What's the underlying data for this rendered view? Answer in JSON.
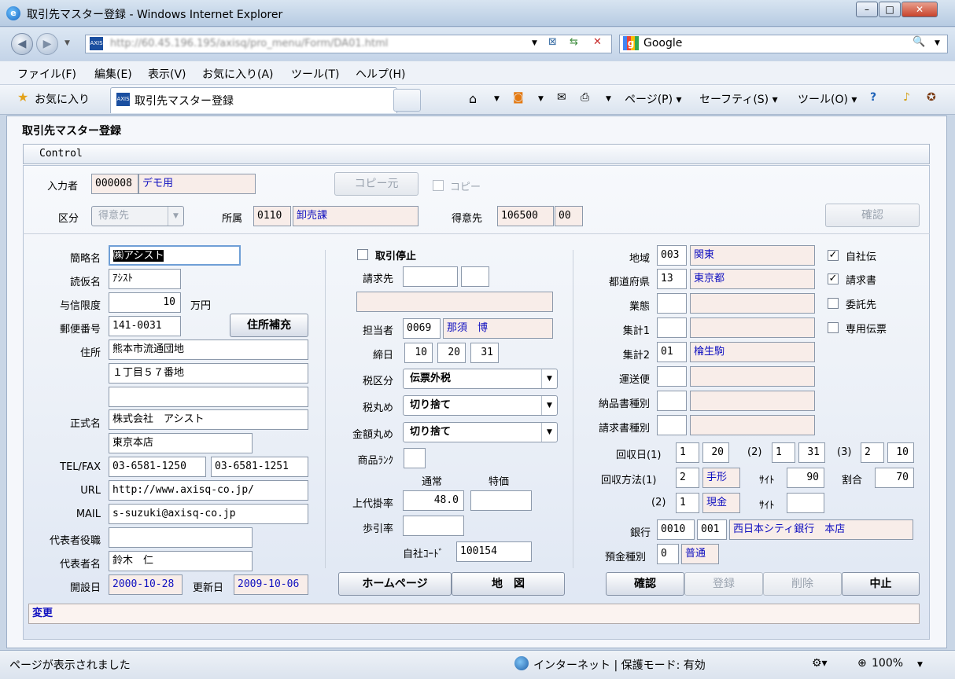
{
  "window": {
    "title": "取引先マスター登録 - Windows Internet Explorer",
    "min": "–",
    "max": "□",
    "close": "✕"
  },
  "address": {
    "url": "http://60.45.196.195/axisq/pro_menu/Form/DA01.html",
    "search_label": "Google",
    "search_icon": "🔍"
  },
  "menu": [
    "ファイル(F)",
    "編集(E)",
    "表示(V)",
    "お気に入り(A)",
    "ツール(T)",
    "ヘルプ(H)"
  ],
  "favorites": {
    "label": "お気に入り",
    "tab_title": "取引先マスター登録"
  },
  "toolbar": {
    "page": "ページ(P) ▾",
    "safety": "セーフティ(S) ▾",
    "tools": "ツール(O) ▾"
  },
  "page": {
    "heading": "取引先マスター登録",
    "control_bar": "Control"
  },
  "header": {
    "input_person_label": "入力者",
    "input_person_code": "000008",
    "input_person_name": "デモ用",
    "copy_source_button": "コピー元",
    "copy_checkbox_label": "コピー",
    "kubun_label": "区分",
    "kubun_value": "得意先",
    "shozoku_label": "所属",
    "shozoku_code": "0110",
    "shozoku_name": "卸売課",
    "tokuisaki_label": "得意先",
    "tokuisaki_code": "106500",
    "tokuisaki_sub": "00",
    "confirm_button": "確認"
  },
  "left": {
    "short_name_label": "簡略名",
    "short_name": "㈱アシスト",
    "kana_label": "読仮名",
    "kana": "ｱｼｽﾄ",
    "credit_label": "与信限度",
    "credit": "10",
    "credit_unit": "万円",
    "zip_label": "郵便番号",
    "zip": "141-0031",
    "address_fill_button": "住所補充",
    "address_label": "住所",
    "address1": "熊本市流通団地",
    "address2": "１丁目５７番地",
    "address3": "",
    "official_label": "正式名",
    "official1": "株式会社　アシスト",
    "official2": "東京本店",
    "telfax_label": "TEL/FAX",
    "tel": "03-6581-1250",
    "fax": "03-6581-1251",
    "url_label": "URL",
    "url": "http://www.axisq-co.jp/",
    "mail_label": "MAIL",
    "mail": "s-suzuki@axisq-co.jp",
    "rep_title_label": "代表者役職",
    "rep_title": "",
    "rep_name_label": "代表者名",
    "rep_name": "鈴木　仁",
    "open_label": "開設日",
    "open_date": "2000-10-28",
    "update_label": "更新日",
    "update_date": "2009-10-06"
  },
  "middle": {
    "stop_label": "取引停止",
    "billing_label": "請求先",
    "billing_code": "",
    "billing_sub": "",
    "billing_name": "",
    "staff_label": "担当者",
    "staff_code": "0069",
    "staff_name": "那須　博",
    "closing_label": "締日",
    "closing1": "10",
    "closing2": "20",
    "closing3": "31",
    "tax_kind_label": "税区分",
    "tax_kind": "伝票外税",
    "tax_round_label": "税丸め",
    "tax_round": "切り捨て",
    "amount_round_label": "金額丸め",
    "amount_round": "切り捨て",
    "rank_label": "商品ﾗﾝｸ",
    "rank": "",
    "normal_label": "通常",
    "special_label": "特価",
    "rate_label": "上代掛率",
    "rate_normal": "48.0",
    "rate_special": "",
    "discount_label": "歩引率",
    "discount": "",
    "own_code_label": "自社ｺｰﾄﾞ",
    "own_code": "100154",
    "homepage_button": "ホームページ",
    "map_button": "地　図"
  },
  "right": {
    "region_label": "地域",
    "region_code": "003",
    "region_name": "関東",
    "pref_label": "都道府県",
    "pref_code": "13",
    "pref_name": "東京都",
    "business_label": "業態",
    "business_code": "",
    "business_name": "",
    "agg1_label": "集計1",
    "agg1_code": "",
    "agg1_name": "",
    "agg2_label": "集計2",
    "agg2_code": "01",
    "agg2_name": "棆生駒",
    "carrier_label": "運送便",
    "carrier_code": "",
    "carrier_name": "",
    "delivery_kind_label": "納品書種別",
    "delivery_kind_code": "",
    "delivery_kind_name": "",
    "invoice_kind_label": "請求書種別",
    "invoice_kind_code": "",
    "invoice_kind_name": "",
    "collect_day_label": "回収日(1)",
    "cd1_a": "1",
    "cd1_b": "20",
    "cd2_label": "(2)",
    "cd2_a": "1",
    "cd2_b": "31",
    "cd3_label": "(3)",
    "cd3_a": "2",
    "cd3_b": "10",
    "collect_method_label": "回収方法(1)",
    "cm1_code": "2",
    "cm1_name": "手形",
    "site_label": "ｻｲﾄ",
    "cm1_site": "90",
    "ratio_label": "割合",
    "cm1_ratio": "70",
    "cm2_label": "(2)",
    "cm2_code": "1",
    "cm2_name": "現金",
    "cm2_site": "",
    "bank_label": "銀行",
    "bank_code": "0010",
    "branch_code": "001",
    "bank_name": "西日本シティ銀行　本店",
    "deposit_label": "預金種別",
    "deposit_code": "0",
    "deposit_name": "普通",
    "own_slip": "自社伝",
    "invoice": "請求書",
    "consign": "委託先",
    "dedicated_slip": "専用伝票",
    "check_mark": "✓",
    "confirm_button": "確認",
    "register_button": "登録",
    "delete_button": "削除",
    "cancel_button": "中止"
  },
  "status_field": "変更",
  "statusbar": {
    "text": "ページが表示されました",
    "zone": "インターネット | 保護モード: 有効",
    "zoom": "100%"
  }
}
